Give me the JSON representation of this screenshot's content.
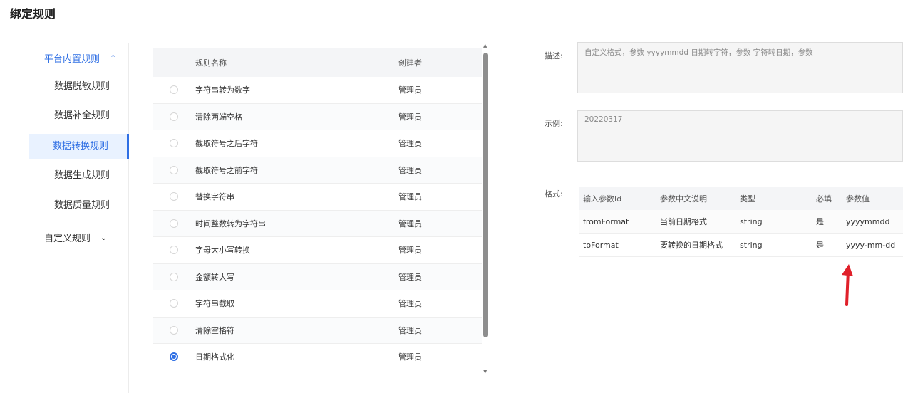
{
  "page": {
    "title": "绑定规则"
  },
  "sidebar": {
    "groups": [
      {
        "label": "平台内置规则",
        "expanded": true,
        "chevron_icon": "chevron-up-icon",
        "items": [
          {
            "label": "数据脱敏规则",
            "active": false
          },
          {
            "label": "数据补全规则",
            "active": false
          },
          {
            "label": "数据转换规则",
            "active": true
          },
          {
            "label": "数据生成规则",
            "active": false
          },
          {
            "label": "数据质量规则",
            "active": false
          }
        ]
      },
      {
        "label": "自定义规则",
        "expanded": false,
        "chevron_icon": "chevron-down-icon",
        "items": []
      }
    ]
  },
  "rules_table": {
    "headers": {
      "name": "规则名称",
      "creator": "创建者"
    },
    "rows": [
      {
        "name": "字符串转为数字",
        "creator": "管理员",
        "selected": false
      },
      {
        "name": "清除两端空格",
        "creator": "管理员",
        "selected": false
      },
      {
        "name": "截取符号之后字符",
        "creator": "管理员",
        "selected": false
      },
      {
        "name": "截取符号之前字符",
        "creator": "管理员",
        "selected": false
      },
      {
        "name": "替换字符串",
        "creator": "管理员",
        "selected": false
      },
      {
        "name": "时间整数转为字符串",
        "creator": "管理员",
        "selected": false
      },
      {
        "name": "字母大小写转换",
        "creator": "管理员",
        "selected": false
      },
      {
        "name": "金额转大写",
        "creator": "管理员",
        "selected": false
      },
      {
        "name": "字符串截取",
        "creator": "管理员",
        "selected": false
      },
      {
        "name": "清除空格符",
        "creator": "管理员",
        "selected": false
      },
      {
        "name": "日期格式化",
        "creator": "管理员",
        "selected": true
      }
    ]
  },
  "details": {
    "description_label": "描述:",
    "description_value": "自定义格式，参数 yyyymmdd 日期转字符，参数 字符转日期，参数",
    "example_label": "示例:",
    "example_value": "20220317",
    "format_label": "格式:",
    "params_headers": [
      "输入参数Id",
      "参数中文说明",
      "类型",
      "必填",
      "参数值"
    ],
    "params_rows": [
      [
        "fromFormat",
        "当前日期格式",
        "string",
        "是",
        "yyyymmdd"
      ],
      [
        "toFormat",
        "要转换的日期格式",
        "string",
        "是",
        "yyyy-mm-dd"
      ]
    ]
  },
  "colors": {
    "accent": "#2f6fe4",
    "annotation_arrow": "#e0202a"
  }
}
